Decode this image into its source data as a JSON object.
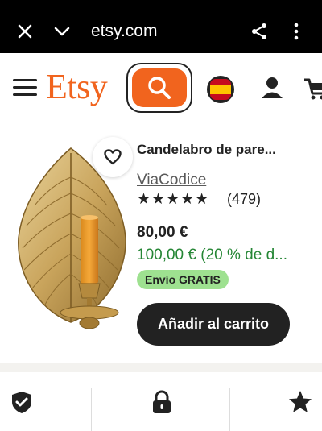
{
  "browser": {
    "url": "etsy.com"
  },
  "header": {
    "logo": "Etsy"
  },
  "product": {
    "title": "Candelabro de pare...",
    "shop": "ViaCodice",
    "stars": "★★★★★",
    "rating": 5,
    "reviews": "(479)",
    "price": "80,00 €",
    "original_price": "100,00 €",
    "discount": " (20 % de d...",
    "shipping_badge": "Envío GRATIS",
    "add_to_cart": "Añadir al carrito"
  },
  "colors": {
    "brand_orange": "#f1641e",
    "discount_green": "#258635",
    "badge_green": "#9ee190",
    "dark": "#222222"
  },
  "icons": {
    "close": "close-icon",
    "chevron": "chevron-down-icon",
    "share": "share-icon",
    "more": "more-vertical-icon",
    "menu": "hamburger-menu-icon",
    "search": "search-icon",
    "flag": "spain-flag-icon",
    "user": "user-icon",
    "cart": "cart-icon",
    "favorite": "heart-icon",
    "shield": "shield-check-icon",
    "lock": "lock-icon",
    "star": "star-icon"
  }
}
